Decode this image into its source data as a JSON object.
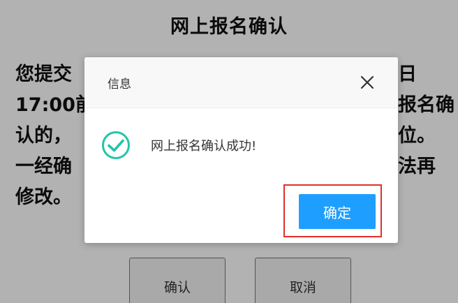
{
  "page": {
    "title": "网上报名确认",
    "notice_left": [
      "您提交",
      "17:00前",
      "认的，",
      "一经确",
      "修改。"
    ],
    "notice_right": [
      "日",
      "报名确",
      "位。",
      "法再"
    ],
    "confirm_label": "确认",
    "cancel_label": "取消"
  },
  "dialog": {
    "title": "信息",
    "close_icon": "close-icon",
    "status_icon": "check-circle-icon",
    "message": "网上报名确认成功!",
    "ok_label": "确定"
  },
  "colors": {
    "primary": "#1e9fff",
    "success": "#23c5a5",
    "highlight": "#e0302a",
    "overlay": "rgba(0,0,0,0.30)"
  }
}
